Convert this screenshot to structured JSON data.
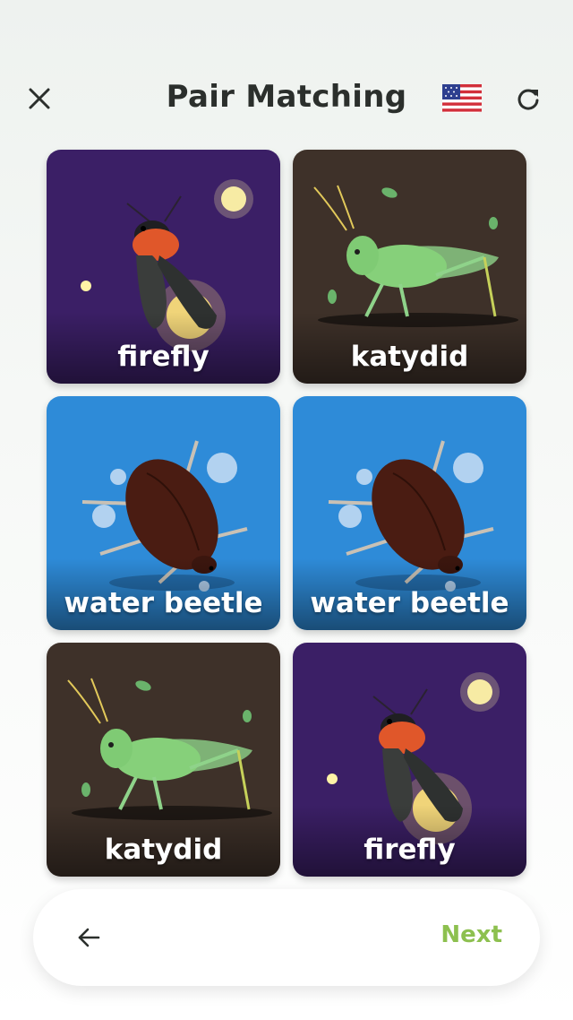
{
  "header": {
    "title": "Pair Matching",
    "flag": "US"
  },
  "cards": [
    {
      "label": "firefly",
      "art": "firefly"
    },
    {
      "label": "katydid",
      "art": "katydid"
    },
    {
      "label": "water beetle",
      "art": "beetle"
    },
    {
      "label": "water beetle",
      "art": "beetle"
    },
    {
      "label": "katydid",
      "art": "katydid"
    },
    {
      "label": "firefly",
      "art": "firefly"
    }
  ],
  "footer": {
    "next_label": "Next"
  },
  "colors": {
    "firefly_bg": "#3b1f66",
    "katydid_bg": "#3e3129",
    "beetle_bg": "#2e8bd8",
    "next_accent": "#8dc04f",
    "title_text": "#2b2f2c"
  },
  "icons": {
    "close": "close-icon",
    "flag": "us-flag-icon",
    "refresh": "refresh-icon",
    "back": "arrow-left-icon"
  }
}
